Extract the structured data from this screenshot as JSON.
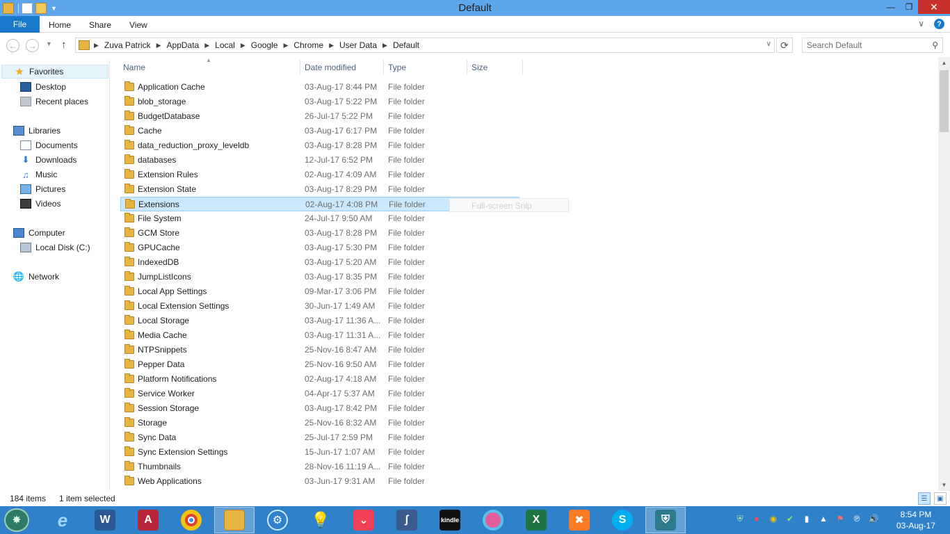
{
  "window": {
    "title": "Default"
  },
  "ribbon": {
    "file": "File",
    "tabs": [
      "Home",
      "Share",
      "View"
    ],
    "help": "?"
  },
  "nav": {
    "breadcrumb": [
      "Zuva Patrick",
      "AppData",
      "Local",
      "Google",
      "Chrome",
      "User Data",
      "Default"
    ],
    "search_placeholder": "Search Default"
  },
  "navpane": {
    "favorites": {
      "label": "Favorites",
      "items": [
        "Desktop",
        "Recent places"
      ]
    },
    "libraries": {
      "label": "Libraries",
      "items": [
        "Documents",
        "Downloads",
        "Music",
        "Pictures",
        "Videos"
      ]
    },
    "computer": {
      "label": "Computer",
      "items": [
        "Local Disk (C:)"
      ]
    },
    "network": {
      "label": "Network"
    }
  },
  "columns": {
    "name": "Name",
    "date": "Date modified",
    "type": "Type",
    "size": "Size"
  },
  "files": [
    {
      "name": "Application Cache",
      "date": "03-Aug-17 8:44 PM",
      "type": "File folder"
    },
    {
      "name": "blob_storage",
      "date": "03-Aug-17 5:22 PM",
      "type": "File folder"
    },
    {
      "name": "BudgetDatabase",
      "date": "26-Jul-17 5:22 PM",
      "type": "File folder"
    },
    {
      "name": "Cache",
      "date": "03-Aug-17 6:17 PM",
      "type": "File folder"
    },
    {
      "name": "data_reduction_proxy_leveldb",
      "date": "03-Aug-17 8:28 PM",
      "type": "File folder"
    },
    {
      "name": "databases",
      "date": "12-Jul-17 6:52 PM",
      "type": "File folder"
    },
    {
      "name": "Extension Rules",
      "date": "02-Aug-17 4:09 AM",
      "type": "File folder"
    },
    {
      "name": "Extension State",
      "date": "03-Aug-17 8:29 PM",
      "type": "File folder"
    },
    {
      "name": "Extensions",
      "date": "02-Aug-17 4:08 PM",
      "type": "File folder",
      "selected": true
    },
    {
      "name": "File System",
      "date": "24-Jul-17 9:50 AM",
      "type": "File folder"
    },
    {
      "name": "GCM Store",
      "date": "03-Aug-17 8:28 PM",
      "type": "File folder"
    },
    {
      "name": "GPUCache",
      "date": "03-Aug-17 5:30 PM",
      "type": "File folder"
    },
    {
      "name": "IndexedDB",
      "date": "03-Aug-17 5:20 AM",
      "type": "File folder"
    },
    {
      "name": "JumpListIcons",
      "date": "03-Aug-17 8:35 PM",
      "type": "File folder"
    },
    {
      "name": "Local App Settings",
      "date": "09-Mar-17 3:06 PM",
      "type": "File folder"
    },
    {
      "name": "Local Extension Settings",
      "date": "30-Jun-17 1:49 AM",
      "type": "File folder"
    },
    {
      "name": "Local Storage",
      "date": "03-Aug-17 11:36 A...",
      "type": "File folder"
    },
    {
      "name": "Media Cache",
      "date": "03-Aug-17 11:31 A...",
      "type": "File folder"
    },
    {
      "name": "NTPSnippets",
      "date": "25-Nov-16 8:47 AM",
      "type": "File folder"
    },
    {
      "name": "Pepper Data",
      "date": "25-Nov-16 9:50 AM",
      "type": "File folder"
    },
    {
      "name": "Platform Notifications",
      "date": "02-Aug-17 4:18 AM",
      "type": "File folder"
    },
    {
      "name": "Service Worker",
      "date": "04-Apr-17 5:37 AM",
      "type": "File folder"
    },
    {
      "name": "Session Storage",
      "date": "03-Aug-17 8:42 PM",
      "type": "File folder"
    },
    {
      "name": "Storage",
      "date": "25-Nov-16 8:32 AM",
      "type": "File folder"
    },
    {
      "name": "Sync Data",
      "date": "25-Jul-17 2:59 PM",
      "type": "File folder"
    },
    {
      "name": "Sync Extension Settings",
      "date": "15-Jun-17 1:07 AM",
      "type": "File folder"
    },
    {
      "name": "Thumbnails",
      "date": "28-Nov-16 11:19 A...",
      "type": "File folder"
    },
    {
      "name": "Web Applications",
      "date": "03-Jun-17 9:31 AM",
      "type": "File folder"
    }
  ],
  "ghost_tooltip": "Full-screen Snip",
  "status": {
    "count": "184 items",
    "selected": "1 item selected"
  },
  "taskbar": {
    "apps": [
      "internet-explorer",
      "word",
      "access",
      "chrome",
      "file-explorer",
      "app",
      "tips",
      "pocket",
      "visual-studio",
      "kindle",
      "color-app",
      "excel",
      "xampp",
      "skype",
      "security"
    ]
  },
  "clock": {
    "time": "8:54 PM",
    "date": "03-Aug-17"
  },
  "colors": {
    "title_bar": "#5ea6eb",
    "file_tab": "#1979ca",
    "taskbar": "#2f82c9",
    "selection": "#cce8ff",
    "close": "#c7302b"
  }
}
